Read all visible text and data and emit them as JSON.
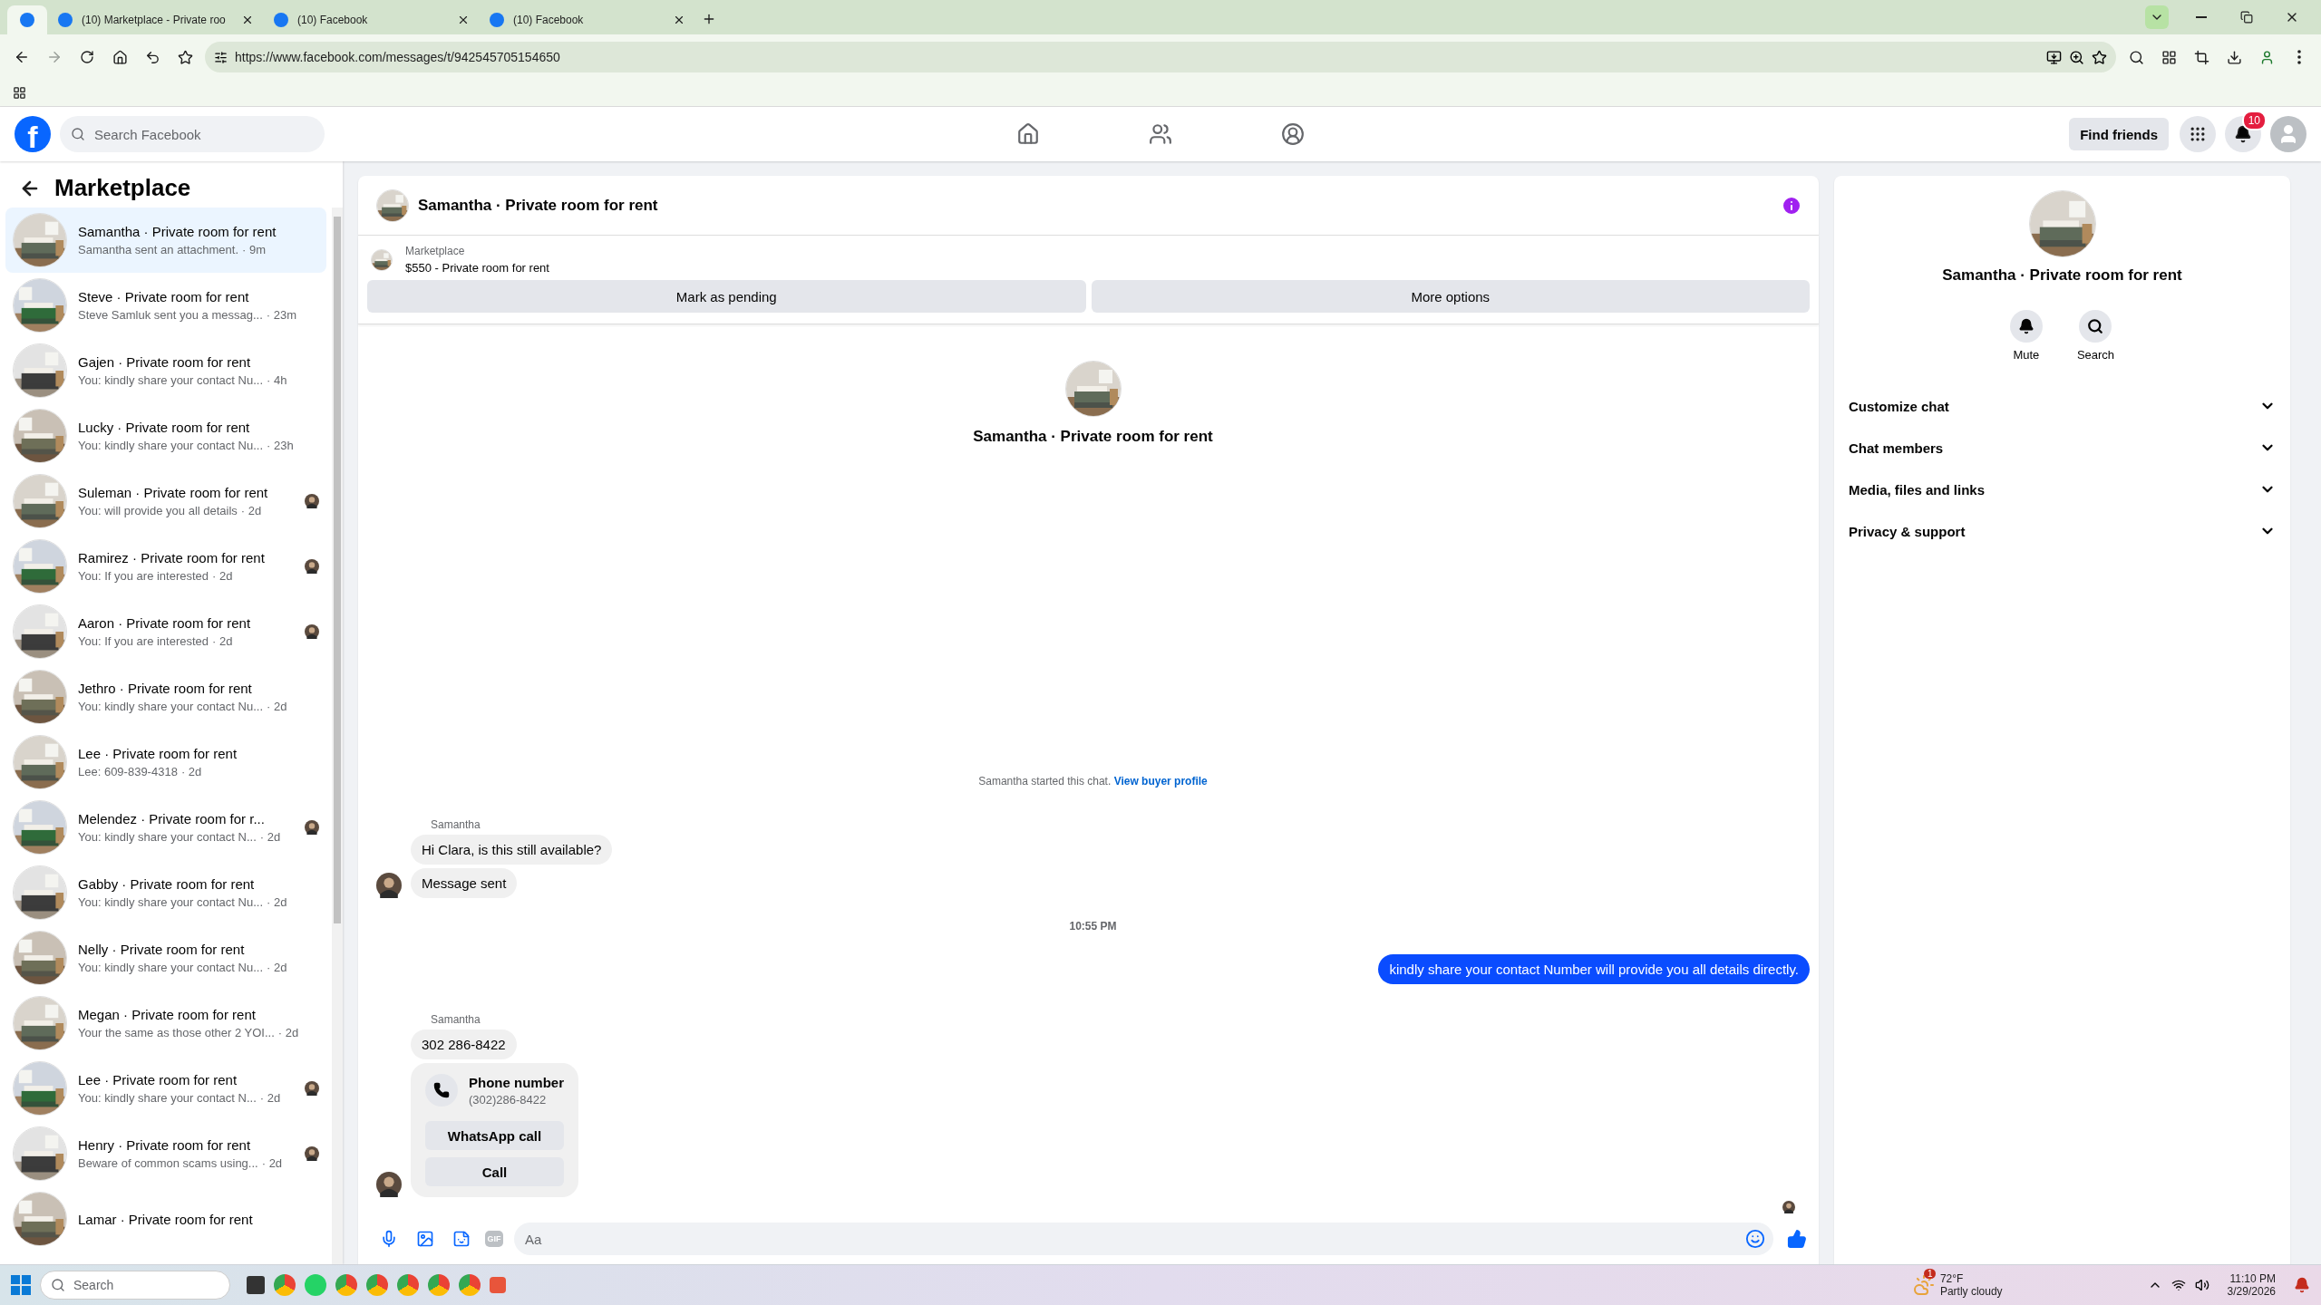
{
  "browser": {
    "tabs": [
      {
        "kind": "pinned",
        "selected": true
      },
      {
        "kind": "page",
        "title": "(10) Marketplace - Private roo",
        "selected": false
      },
      {
        "kind": "page",
        "title": "(10) Facebook",
        "selected": false
      },
      {
        "kind": "page",
        "title": "(10) Facebook",
        "selected": false
      }
    ],
    "url": "https://www.facebook.com/messages/t/942545705154650"
  },
  "header": {
    "logo": "f",
    "search_placeholder": "Search Facebook",
    "find_friends": "Find friends",
    "notification_count": "10"
  },
  "sidebar": {
    "title": "Marketplace",
    "conversations": [
      {
        "title": "Samantha · Private room for rent",
        "preview": "Samantha sent an attachment.",
        "time": "· 9m",
        "selected": true,
        "seen": false
      },
      {
        "title": "Steve · Private room for rent",
        "preview": "Steve Samluk sent you a messag...",
        "time": "· 23m",
        "selected": false,
        "seen": false
      },
      {
        "title": "Gajen · Private room for rent",
        "preview": "You: kindly share your contact Nu...",
        "time": "· 4h",
        "selected": false,
        "seen": false
      },
      {
        "title": "Lucky · Private room for rent",
        "preview": "You: kindly share your contact Nu...",
        "time": "· 23h",
        "selected": false,
        "seen": false
      },
      {
        "title": "Suleman · Private room for rent",
        "preview": "You: will provide you all details",
        "time": "· 2d",
        "selected": false,
        "seen": true
      },
      {
        "title": "Ramirez · Private room for rent",
        "preview": "You: If you are interested",
        "time": "· 2d",
        "selected": false,
        "seen": true
      },
      {
        "title": "Aaron · Private room for rent",
        "preview": "You: If you are interested",
        "time": "· 2d",
        "selected": false,
        "seen": true
      },
      {
        "title": "Jethro · Private room for rent",
        "preview": "You: kindly share your contact Nu...",
        "time": "· 2d",
        "selected": false,
        "seen": false
      },
      {
        "title": "Lee · Private room for rent",
        "preview": "Lee: 609-839-4318",
        "time": "· 2d",
        "selected": false,
        "seen": false
      },
      {
        "title": "Melendez · Private room for r...",
        "preview": "You: kindly share your contact N...",
        "time": "· 2d",
        "selected": false,
        "seen": true
      },
      {
        "title": "Gabby · Private room for rent",
        "preview": "You: kindly share your contact Nu...",
        "time": "· 2d",
        "selected": false,
        "seen": false
      },
      {
        "title": "Nelly · Private room for rent",
        "preview": "You: kindly share your contact Nu...",
        "time": "· 2d",
        "selected": false,
        "seen": false
      },
      {
        "title": "Megan · Private room for rent",
        "preview": "Your the same as those other 2 YOI...",
        "time": "· 2d",
        "selected": false,
        "seen": false
      },
      {
        "title": "Lee · Private room for rent",
        "preview": "You: kindly share your contact N...",
        "time": "· 2d",
        "selected": false,
        "seen": true
      },
      {
        "title": "Henry · Private room for rent",
        "preview": "Beware of common scams using...",
        "time": "· 2d",
        "selected": false,
        "seen": true
      },
      {
        "title": "Lamar · Private room for rent",
        "selected": false,
        "seen": false
      }
    ]
  },
  "chat": {
    "title": "Samantha · Private room for rent",
    "listing": {
      "source": "Marketplace",
      "summary": "$550 - Private room for rent"
    },
    "actions": [
      "Mark as pending",
      "More options"
    ],
    "intro_title": "Samantha · Private room for rent",
    "messages": [
      {
        "kind": "notice",
        "text": "Samantha started this chat.",
        "link": "View buyer profile"
      },
      {
        "kind": "sender",
        "text": "Samantha"
      },
      {
        "kind": "incoming",
        "text": "Hi Clara, is this still available?",
        "avatar": false
      },
      {
        "kind": "incoming",
        "text": "Message sent",
        "avatar": true
      },
      {
        "kind": "time",
        "text": "10:55 PM"
      },
      {
        "kind": "outgoing",
        "text": "kindly share your contact Number will provide you all details directly."
      },
      {
        "kind": "sender",
        "text": "Samantha"
      },
      {
        "kind": "incoming",
        "text": "302 286-8422",
        "avatar": false
      },
      {
        "kind": "contact",
        "title": "Phone number",
        "subtitle": "(302)286-8422",
        "buttons": [
          "WhatsApp call",
          "Call"
        ],
        "avatar": true
      },
      {
        "kind": "seen"
      }
    ],
    "composer": {
      "gif": "GIF",
      "placeholder": "Aa"
    }
  },
  "details": {
    "title": "Samantha · Private room for rent",
    "actions": [
      {
        "kind": "mute",
        "label": "Mute"
      },
      {
        "kind": "search",
        "label": "Search"
      }
    ],
    "sections": [
      {
        "label": "Customize chat",
        "expanded": false
      },
      {
        "label": "Chat members",
        "expanded": false
      },
      {
        "label": "Media, files and links",
        "expanded": false
      },
      {
        "label": "Privacy & support",
        "expanded": false
      }
    ]
  },
  "taskbar": {
    "search_placeholder": "Search",
    "weather": {
      "badge": "1",
      "temperature": "72°F",
      "condition": "Partly cloudy"
    },
    "time": "11:10 PM",
    "date": "3/29/2026"
  }
}
